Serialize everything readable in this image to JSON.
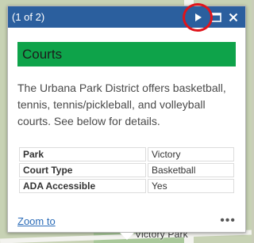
{
  "popup": {
    "pager": "(1 of 2)",
    "title": "Courts",
    "description": "The Urbana Park District offers basketball, tennis, tennis/pickleball, and volleyball courts. See below for details.",
    "attributes": [
      {
        "key": "Park",
        "value": "Victory"
      },
      {
        "key": "Court Type",
        "value": "Basketball"
      },
      {
        "key": "ADA Accessible",
        "value": "Yes"
      }
    ],
    "zoom_label": "Zoom to",
    "more_label": "•••"
  },
  "map": {
    "label": "Victory Park"
  },
  "colors": {
    "header": "#2b5f9e",
    "title_bar": "#0ea34a",
    "highlight": "#e0141b"
  }
}
